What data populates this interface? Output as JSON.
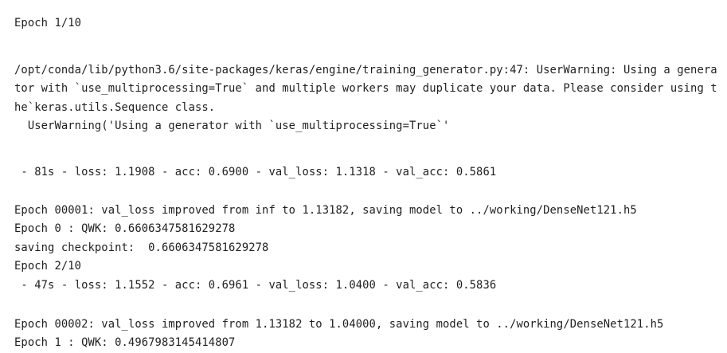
{
  "output": {
    "lines": [
      "Epoch 1/10",
      "/opt/conda/lib/python3.6/site-packages/keras/engine/training_generator.py:47: UserWarning: Using a genera",
      "tor with `use_multiprocessing=True` and multiple workers may duplicate your data. Please consider using t",
      "he`keras.utils.Sequence class.",
      "  UserWarning('Using a generator with `use_multiprocessing=True`'",
      " - 81s - loss: 1.1908 - acc: 0.6900 - val_loss: 1.1318 - val_acc: 0.5861",
      "Epoch 00001: val_loss improved from inf to 1.13182, saving model to ../working/DenseNet121.h5",
      "Epoch 0 : QWK: 0.6606347581629278",
      "saving checkpoint:  0.6606347581629278",
      "Epoch 2/10",
      " - 47s - loss: 1.1552 - acc: 0.6961 - val_loss: 1.0400 - val_acc: 0.5836",
      "Epoch 00002: val_loss improved from 1.13182 to 1.04000, saving model to ../working/DenseNet121.h5",
      "Epoch 1 : QWK: 0.4967983145414807"
    ]
  }
}
